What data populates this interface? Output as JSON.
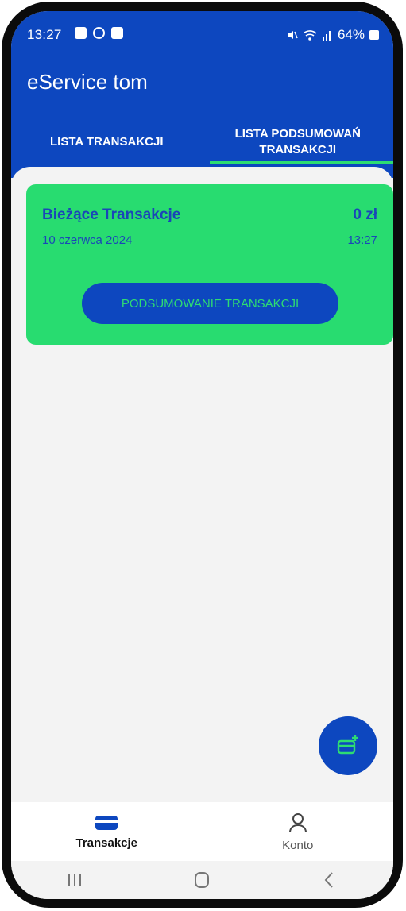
{
  "status_bar": {
    "time": "13:27",
    "battery_percent": "64%",
    "icons": [
      "gallery-icon",
      "location-icon",
      "checkbox-icon",
      "mute-icon",
      "wifi-icon",
      "signal-icon",
      "battery-icon"
    ]
  },
  "app": {
    "title": "eService tom"
  },
  "tabs": [
    {
      "label": "LISTA TRANSAKCJI",
      "selected": false
    },
    {
      "label": "LISTA PODSUMOWAŃ TRANSAKCJI",
      "selected": true
    }
  ],
  "card": {
    "title": "Bieżące Transakcje",
    "amount": "0 zł",
    "date": "10 czerwca 2024",
    "time": "13:27",
    "button_label": "PODSUMOWANIE TRANSAKCJI"
  },
  "bottom_nav": [
    {
      "label": "Transakcje",
      "icon": "card-icon",
      "active": true
    },
    {
      "label": "Konto",
      "icon": "person-icon",
      "active": false
    }
  ],
  "fab": {
    "icon": "add-card-icon"
  },
  "colors": {
    "primary_blue": "#0d47bf",
    "accent_green": "#28dc70",
    "card_text": "#1a46b8"
  }
}
